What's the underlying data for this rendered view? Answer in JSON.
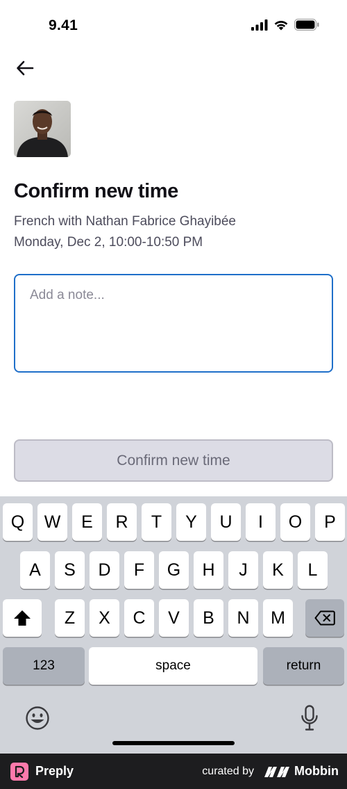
{
  "status_bar": {
    "time": "9.41"
  },
  "header": {
    "title": "Confirm new time"
  },
  "lesson": {
    "description": "French with Nathan Fabrice Ghayibée",
    "datetime": "Monday, Dec 2, 10:00-10:50 PM"
  },
  "note": {
    "placeholder": "Add a note...",
    "value": ""
  },
  "confirm_button": {
    "label": "Confirm new time"
  },
  "keyboard": {
    "row1": [
      "Q",
      "W",
      "E",
      "R",
      "T",
      "Y",
      "U",
      "I",
      "O",
      "P"
    ],
    "row2": [
      "A",
      "S",
      "D",
      "F",
      "G",
      "H",
      "J",
      "K",
      "L"
    ],
    "row3": [
      "Z",
      "X",
      "C",
      "V",
      "B",
      "N",
      "M"
    ],
    "numbers_label": "123",
    "space_label": "space",
    "return_label": "return"
  },
  "footer": {
    "app_name": "Preply",
    "curated_by": "curated by",
    "brand": "Mobbin"
  },
  "colors": {
    "accent": "#1f6fc9",
    "button_disabled_bg": "#dcdce5",
    "keyboard_bg": "#d0d3d9",
    "preply_pink": "#ff7aac"
  }
}
